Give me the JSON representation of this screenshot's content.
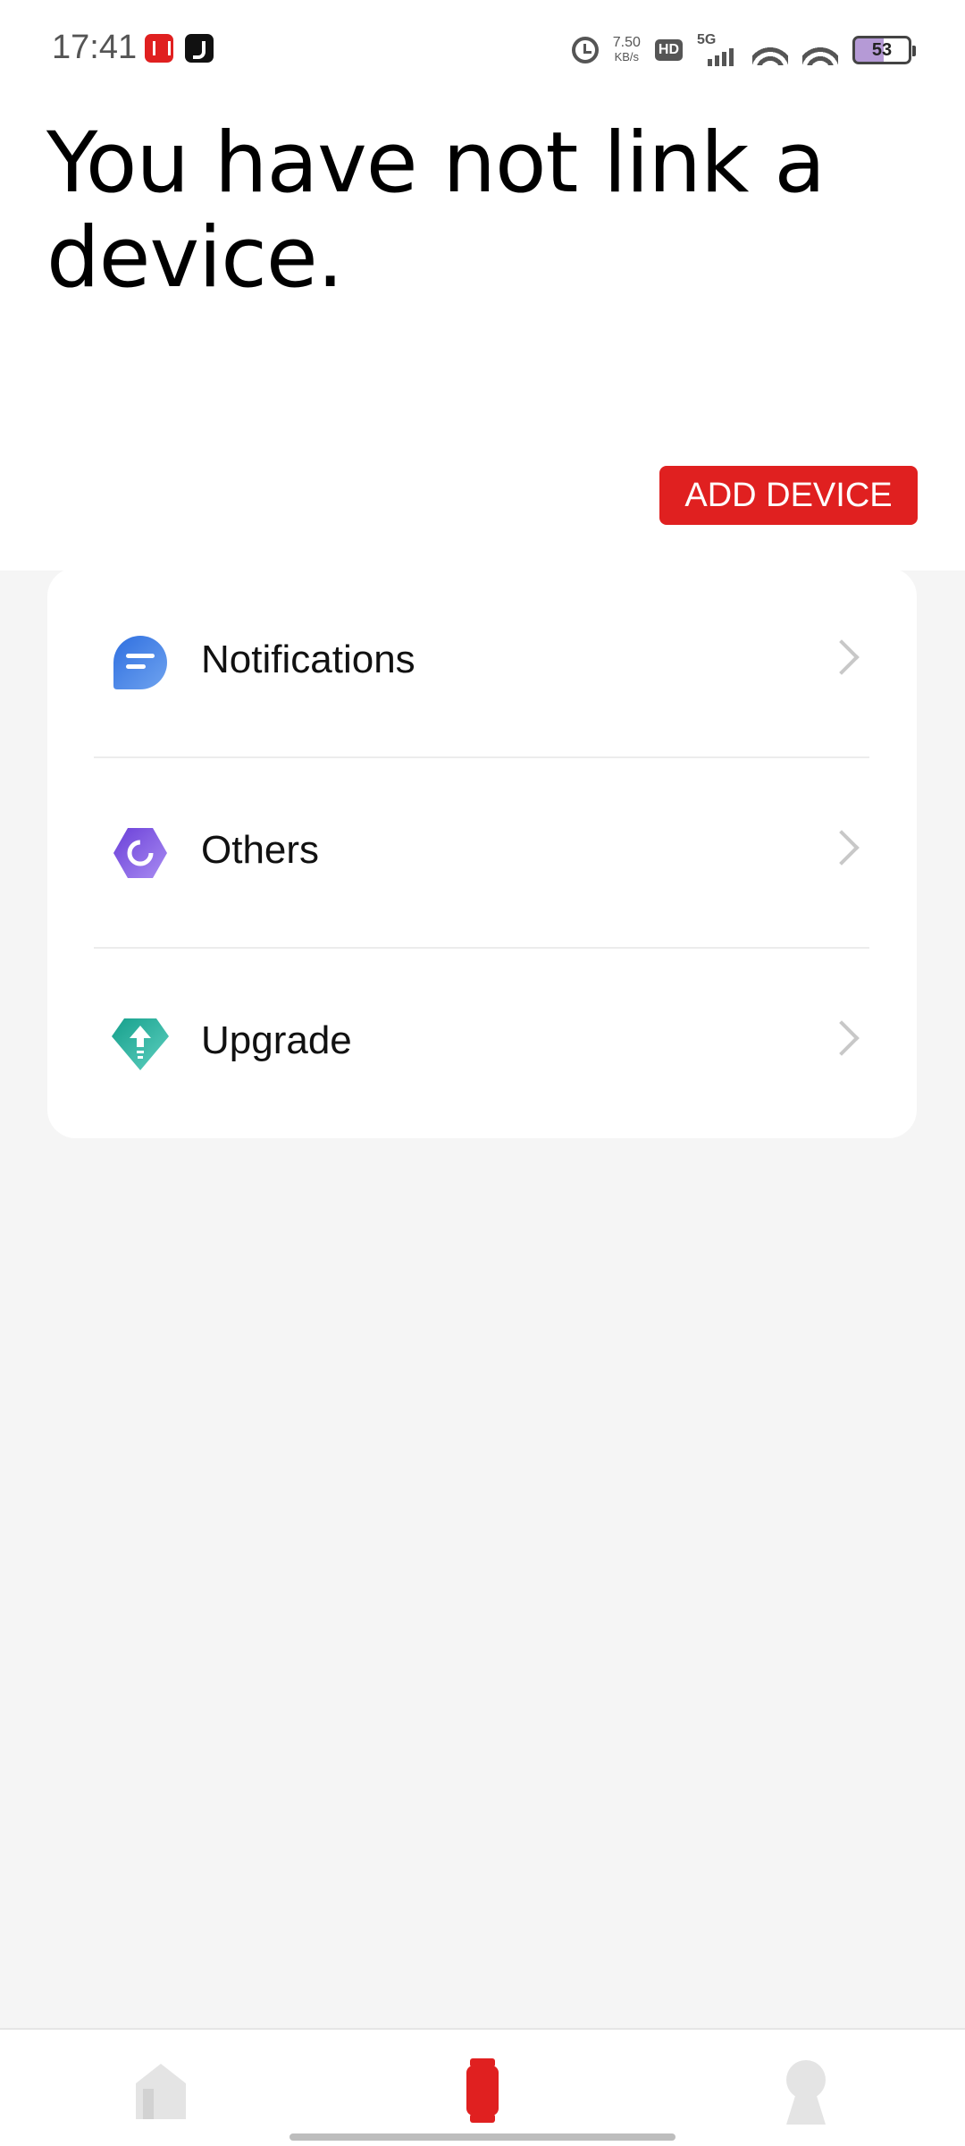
{
  "status_bar": {
    "time": "17:41",
    "net_speed_value": "7.50",
    "net_speed_unit": "KB/s",
    "hd_label": "HD",
    "network_label": "5G",
    "battery_level": "53",
    "icons": [
      "app-badge-icon",
      "tiktok-icon",
      "alarm-icon",
      "wifi-icon",
      "battery-icon"
    ]
  },
  "header": {
    "title": "You have not link a device."
  },
  "add_device_button": {
    "label": "ADD DEVICE",
    "color": "#e02020"
  },
  "menu": {
    "items": [
      {
        "label": "Notifications",
        "icon": "notifications-icon",
        "color": "#3b7ddd"
      },
      {
        "label": "Others",
        "icon": "others-icon",
        "color": "#7b56e3"
      },
      {
        "label": "Upgrade",
        "icon": "upgrade-icon",
        "color": "#1fae9c"
      }
    ]
  },
  "bottom_nav": {
    "items": [
      {
        "icon": "home-icon",
        "active": false
      },
      {
        "icon": "watch-icon",
        "active": true
      },
      {
        "icon": "profile-icon",
        "active": false
      }
    ],
    "active_color": "#e02020",
    "inactive_color": "#e0e0e0"
  }
}
